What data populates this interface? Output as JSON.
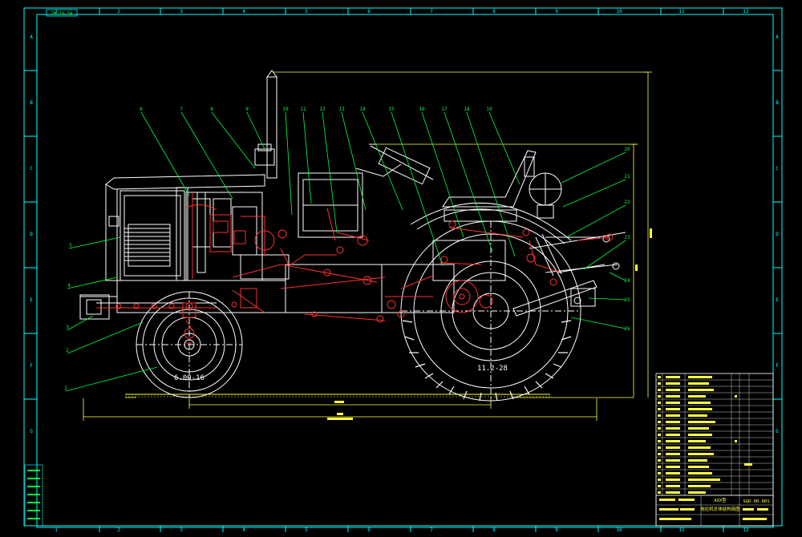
{
  "drawing": {
    "corner_tag": "7M-18-5W",
    "col_labels": [
      "1",
      "2",
      "3",
      "4",
      "5",
      "6",
      "7",
      "8",
      "9",
      "10",
      "11",
      "12"
    ],
    "row_labels": [
      "A",
      "B",
      "C",
      "D",
      "E",
      "F",
      "G"
    ],
    "row_labels_right": [
      "A",
      "B",
      "C",
      "D",
      "E",
      "F",
      "G"
    ],
    "callouts": [
      "1",
      "2",
      "3",
      "4",
      "5",
      "6",
      "7",
      "8",
      "9",
      "10",
      "11",
      "12",
      "13",
      "14",
      "15",
      "16",
      "17",
      "18",
      "19",
      "20",
      "21",
      "22",
      "23",
      "24",
      "25",
      "26"
    ],
    "front_tire_label": "6.00-16",
    "rear_tire_label": "11.2-28",
    "title_block": {
      "drawing_number": "SGD.00.001",
      "model": "AXX型",
      "title": "拖拉机总体结构简图"
    }
  },
  "colors": {
    "background": "#000000",
    "frame": "#00ffff",
    "body": "#ffffff",
    "parts": "#ff3030",
    "leaders": "#00ff40",
    "dimension": "#ffff40"
  }
}
